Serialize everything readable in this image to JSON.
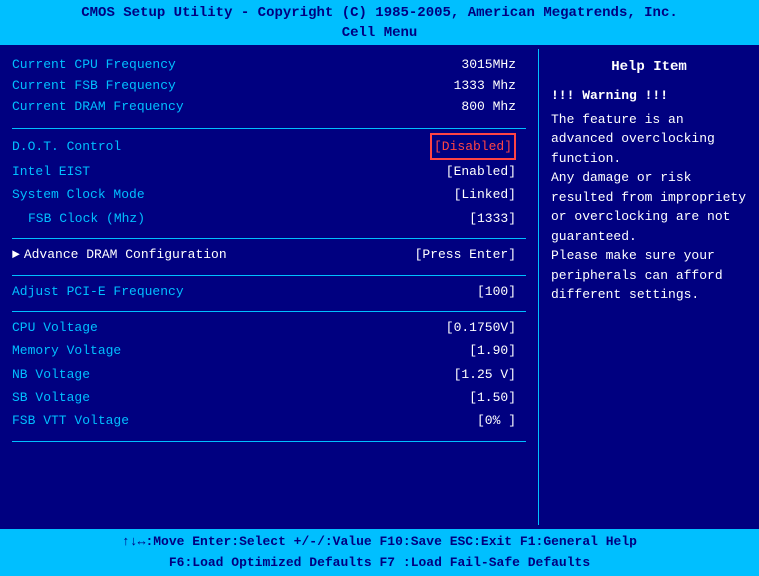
{
  "title_line1": "CMOS Setup Utility - Copyright (C) 1985-2005, American Megatrends, Inc.",
  "title_line2": "Cell Menu",
  "info": {
    "cpu_freq_label": "Current CPU Frequency",
    "cpu_freq_value": "3015MHz",
    "fsb_freq_label": "Current FSB Frequency",
    "fsb_freq_value": "1333 Mhz",
    "dram_freq_label": "Current DRAM Frequency",
    "dram_freq_value": "800 Mhz"
  },
  "settings": {
    "dot_control_label": "D.O.T. Control",
    "dot_control_value": "[Disabled]",
    "intel_eist_label": "Intel EIST",
    "intel_eist_value": "[Enabled]",
    "sys_clock_label": "System Clock Mode",
    "sys_clock_value": "[Linked]",
    "fsb_clock_label": "FSB Clock (Mhz)",
    "fsb_clock_value": "[1333]",
    "advance_label": "Advance DRAM Configuration",
    "advance_value": "[Press Enter]",
    "pcie_label": "Adjust PCI-E Frequency",
    "pcie_value": "[100]"
  },
  "voltages": {
    "cpu_label": "CPU Voltage",
    "cpu_value": "[0.1750V]",
    "memory_label": "Memory Voltage",
    "memory_value": "[1.90]",
    "nb_label": "NB Voltage",
    "nb_value": "[1.25 V]",
    "sb_label": "SB Voltage",
    "sb_value": "[1.50]",
    "fsb_vtt_label": "FSB VTT Voltage",
    "fsb_vtt_value": "[0%  ]"
  },
  "help": {
    "title": "Help Item",
    "warning": "!!! Warning !!!",
    "text": "The feature is an advanced overclocking function.\nAny damage or risk resulted from impropriety or overclocking are not guaranteed.\nPlease make sure your peripherals can afford different settings."
  },
  "footer": {
    "line1": "↑↓↔:Move   Enter:Select   +/-/:Value   F10:Save   ESC:Exit   F1:General Help",
    "line2": "F6:Load Optimized Defaults               F7 :Load Fail-Safe Defaults"
  }
}
